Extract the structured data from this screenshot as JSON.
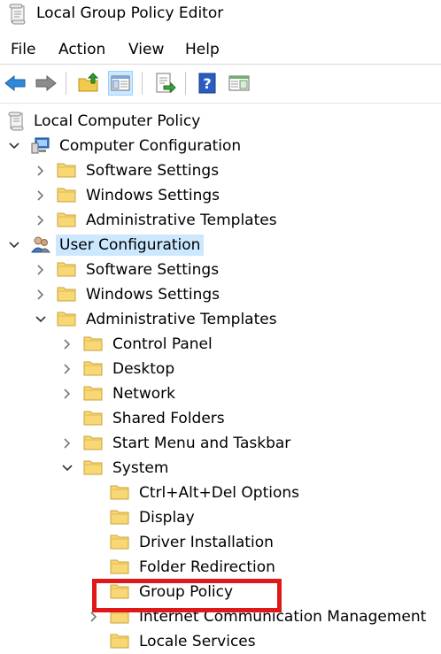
{
  "window": {
    "title": "Local Group Policy Editor"
  },
  "menu": [
    "File",
    "Action",
    "View",
    "Help"
  ],
  "toolbar": {
    "buttons": [
      "back-arrow-icon",
      "forward-arrow-icon",
      "up-folder-icon",
      "show-hide-tree-icon",
      "export-list-icon",
      "help-icon",
      "extended-view-icon"
    ]
  },
  "tree": {
    "root": "Local Computer Policy",
    "computer_configuration": {
      "label": "Computer Configuration",
      "children": [
        "Software Settings",
        "Windows Settings",
        "Administrative Templates"
      ]
    },
    "user_configuration": {
      "label": "User Configuration",
      "children": [
        "Software Settings",
        "Windows Settings",
        "Administrative Templates"
      ]
    },
    "admin_templates_children": [
      "Control Panel",
      "Desktop",
      "Network",
      "Shared Folders",
      "Start Menu and Taskbar",
      "System"
    ],
    "system_children": [
      "Ctrl+Alt+Del Options",
      "Display",
      "Driver Installation",
      "Folder Redirection",
      "Group Policy",
      "Internet Communication Management",
      "Locale Services"
    ]
  },
  "colors": {
    "selection": "#cce8ff",
    "annotation_box": "#e01818",
    "folder": "#f8d775"
  }
}
